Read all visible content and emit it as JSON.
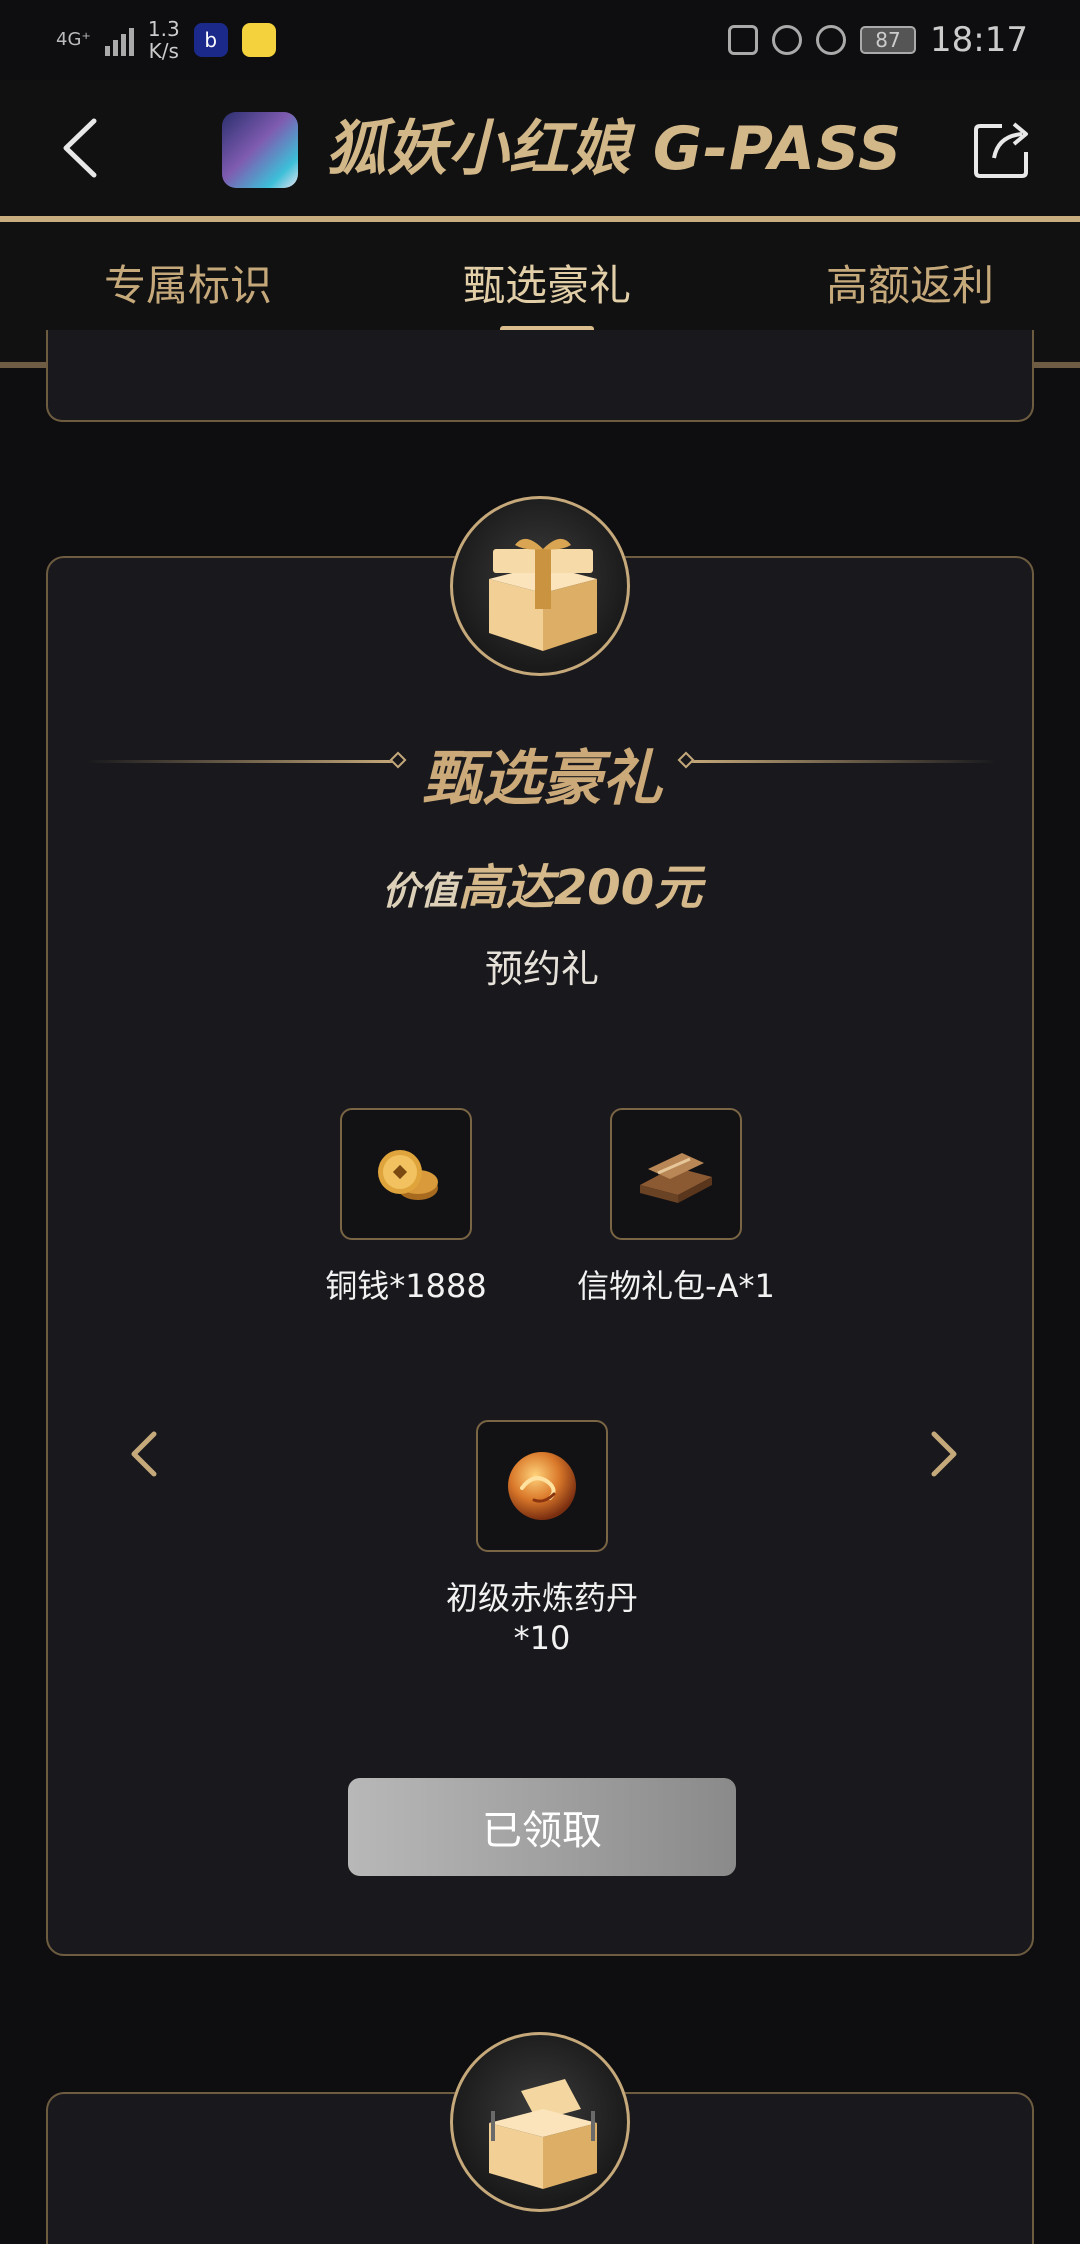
{
  "status_bar": {
    "network": "4G⁺",
    "speed_value": "1.3",
    "speed_unit": "K/s",
    "battery": "87",
    "time": "18:17"
  },
  "header": {
    "title": "狐妖小红娘 G-PASS"
  },
  "tabs": [
    {
      "label": "专属标识",
      "active": false
    },
    {
      "label": "甄选豪礼",
      "active": true
    },
    {
      "label": "高额返利",
      "active": false
    }
  ],
  "card": {
    "title": "甄选豪礼",
    "value_prefix": "价值",
    "value_main": "高达200元",
    "subtitle": "预约礼",
    "rewards": [
      {
        "label": "铜钱*1888",
        "icon": "copper-coins-icon"
      },
      {
        "label": "信物礼包-A*1",
        "icon": "token-pack-icon"
      },
      {
        "label": "初级赤炼药丹\n*10",
        "label_line1": "初级赤炼药丹",
        "label_line2": "*10",
        "icon": "elixir-pill-icon"
      }
    ],
    "claim_button": "已领取"
  },
  "colors": {
    "accent_gold": "#c6a97a",
    "background": "#0e0e10",
    "card_background": "#19191d"
  }
}
